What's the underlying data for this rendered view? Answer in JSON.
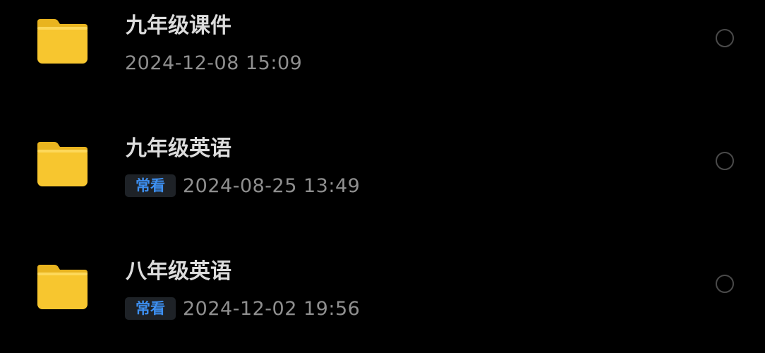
{
  "colors": {
    "background": "#000000",
    "folder": "#f7c62f",
    "tag_text": "#3d8ff0",
    "tag_bg": "#1e2227"
  },
  "files": [
    {
      "name": "九年级课件",
      "icon": "folder-icon",
      "tag": "",
      "time": "2024-12-08 15:09"
    },
    {
      "name": "九年级英语",
      "icon": "folder-icon",
      "tag": "常看",
      "time": "2024-08-25 13:49"
    },
    {
      "name": "八年级英语",
      "icon": "folder-icon",
      "tag": "常看",
      "time": "2024-12-02 19:56"
    }
  ]
}
